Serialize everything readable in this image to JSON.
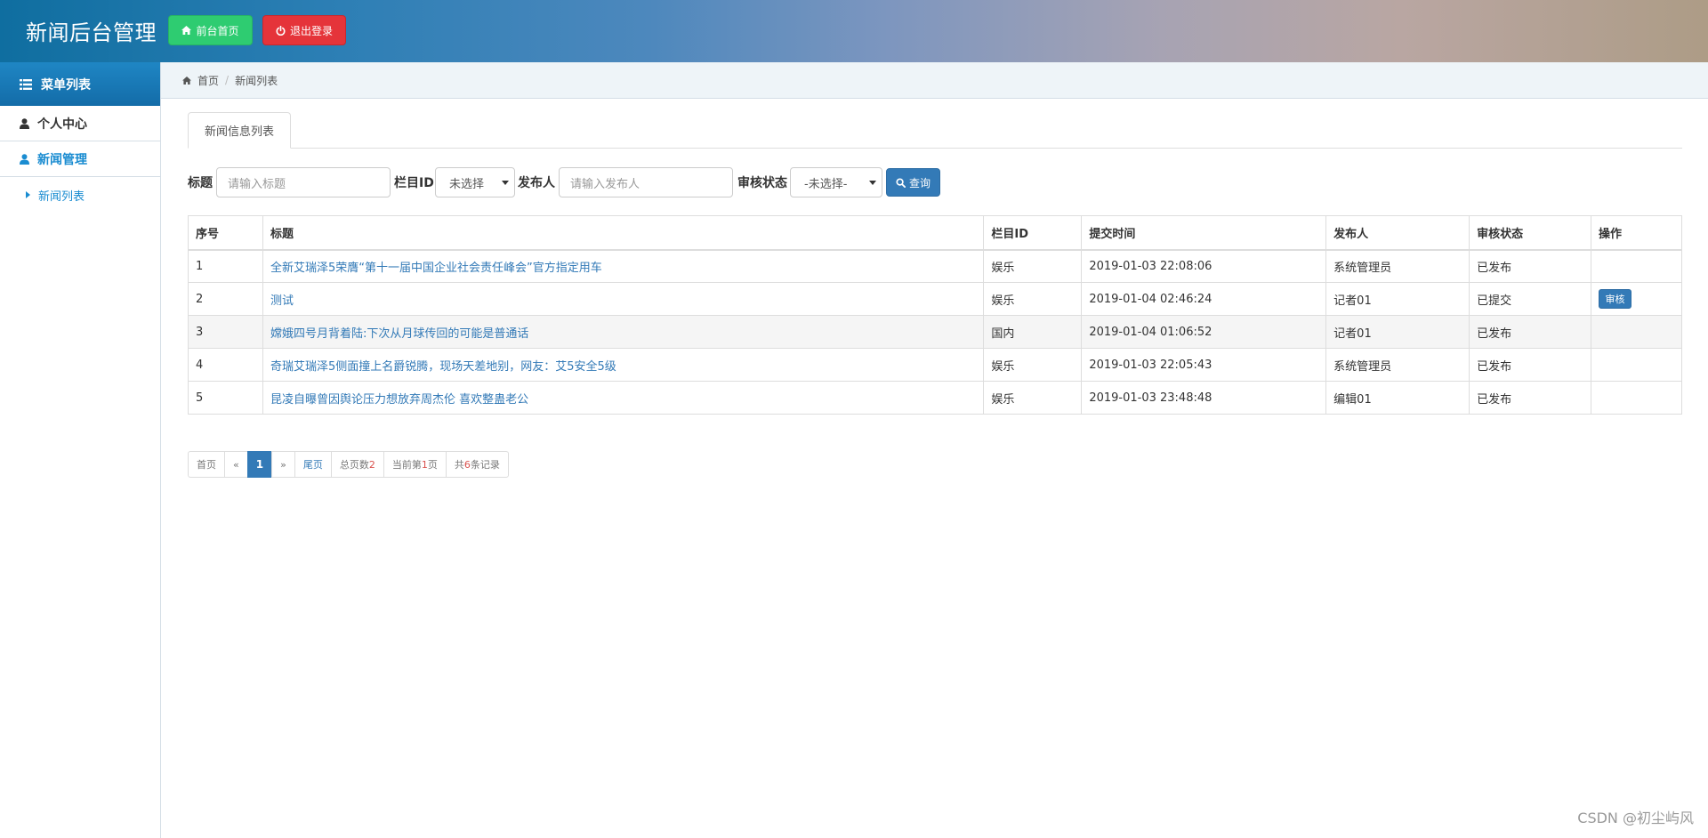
{
  "header": {
    "brand": "新闻后台管理",
    "home_button": "前台首页",
    "logout_button": "退出登录"
  },
  "sidebar": {
    "title": "菜单列表",
    "items": [
      {
        "label": "个人中心"
      },
      {
        "label": "新闻管理"
      }
    ],
    "sub_items": [
      {
        "label": "新闻列表"
      }
    ]
  },
  "breadcrumb": {
    "home": "首页",
    "current": "新闻列表"
  },
  "tab": {
    "label": "新闻信息列表"
  },
  "filters": {
    "title_label": "标题",
    "title_placeholder": "请输入标题",
    "column_label": "栏目ID",
    "column_value": "未选择",
    "publisher_label": "发布人",
    "publisher_placeholder": "请输入发布人",
    "status_label": "审核状态",
    "status_value": "-未选择-",
    "search_button": "查询"
  },
  "table": {
    "headers": [
      "序号",
      "标题",
      "栏目ID",
      "提交时间",
      "发布人",
      "审核状态",
      "操作"
    ],
    "rows": [
      {
        "no": "1",
        "title": "全新艾瑞泽5荣膺“第十一届中国企业社会责任峰会”官方指定用车",
        "column": "娱乐",
        "time": "2019-01-03 22:08:06",
        "publisher": "系统管理员",
        "status": "已发布",
        "action": ""
      },
      {
        "no": "2",
        "title": "测试",
        "column": "娱乐",
        "time": "2019-01-04 02:46:24",
        "publisher": "记者01",
        "status": "已提交",
        "action": "审核"
      },
      {
        "no": "3",
        "title": "嫦娥四号月背着陆:下次从月球传回的可能是普通话",
        "column": "国内",
        "time": "2019-01-04 01:06:52",
        "publisher": "记者01",
        "status": "已发布",
        "action": ""
      },
      {
        "no": "4",
        "title": "奇瑞艾瑞泽5侧面撞上名爵锐腾，现场天差地别，网友：艾5安全5级",
        "column": "娱乐",
        "time": "2019-01-03 22:05:43",
        "publisher": "系统管理员",
        "status": "已发布",
        "action": ""
      },
      {
        "no": "5",
        "title": "昆凌自曝曾因舆论压力想放弃周杰伦 喜欢整蛊老公",
        "column": "娱乐",
        "time": "2019-01-03 23:48:48",
        "publisher": "编辑01",
        "status": "已发布",
        "action": ""
      }
    ]
  },
  "pagination": {
    "first": "首页",
    "prev": "«",
    "current": "1",
    "next": "»",
    "last": "尾页",
    "total_pages_prefix": "总页数",
    "total_pages": "2",
    "current_page_prefix": "当前第",
    "current_page": "1",
    "current_page_suffix": "页",
    "total_records_prefix": "共",
    "total_records": "6",
    "total_records_suffix": "条记录"
  },
  "watermark": "CSDN @初尘屿风",
  "colors": {
    "primary": "#337ab7",
    "success": "#2ecc71",
    "danger": "#e5343a",
    "accent": "#1a8cd1"
  }
}
